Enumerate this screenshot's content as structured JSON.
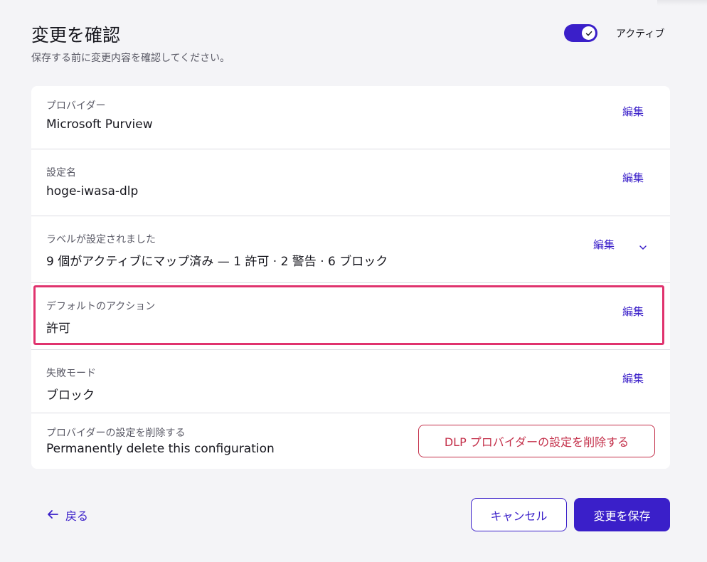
{
  "header": {
    "title": "変更を確認",
    "subtitle": "保存する前に変更内容を確認してください。",
    "toggle_label": "アクティブ",
    "toggle_on": true
  },
  "rows": [
    {
      "label": "プロバイダー",
      "value": "Microsoft Purview",
      "edit": "編集"
    },
    {
      "label": "設定名",
      "value": "hoge-iwasa-dlp",
      "edit": "編集"
    },
    {
      "label": "ラベルが設定されました",
      "value": "9 個がアクティブにマップ済み — 1 許可 · 2 警告 · 6 ブロック",
      "edit": "編集",
      "icon": "chevron-down-icon"
    },
    {
      "label": "デフォルトのアクション",
      "value": "許可",
      "edit": "編集"
    },
    {
      "label": "失敗モード",
      "value": "ブロック",
      "edit": "編集"
    }
  ],
  "delete_section": {
    "label": "プロバイダーの設定を削除する",
    "value": "Permanently delete this configuration",
    "button": "DLP プロバイダーの設定を削除する"
  },
  "footer": {
    "back": "戻る",
    "cancel": "キャンセル",
    "save": "変更を保存"
  },
  "colors": {
    "accent": "#3a1fc9",
    "danger": "#c4314b",
    "highlight": "#e0336e"
  }
}
